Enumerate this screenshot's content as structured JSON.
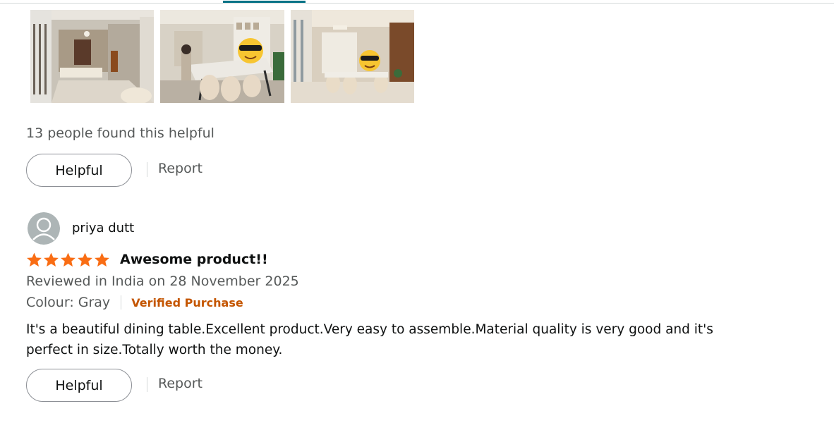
{
  "review_images": [
    {
      "name": "review-image-1"
    },
    {
      "name": "review-image-2"
    },
    {
      "name": "review-image-3"
    }
  ],
  "previous_review": {
    "helpful_count_text": "13 people found this helpful",
    "helpful_label": "Helpful",
    "report_label": "Report"
  },
  "review": {
    "reviewer_name": "priya dutt",
    "rating": 5,
    "rating_max": 5,
    "title": "Awesome product!!",
    "meta": "Reviewed in India on 28 November 2025",
    "colour": "Colour: Gray",
    "verified_label": "Verified Purchase",
    "body": "It's a beautiful dining table.Excellent product.Very easy to assemble.Material quality is very good and it's perfect in size.Totally worth the money.",
    "helpful_label": "Helpful",
    "report_label": "Report"
  },
  "colors": {
    "star": "#f96d14",
    "verified": "#c45500",
    "secondary_text": "#565959",
    "tab_accent": "#007185"
  },
  "icons": {
    "avatar": "default-user-avatar-icon",
    "star": "filled-star-icon"
  }
}
